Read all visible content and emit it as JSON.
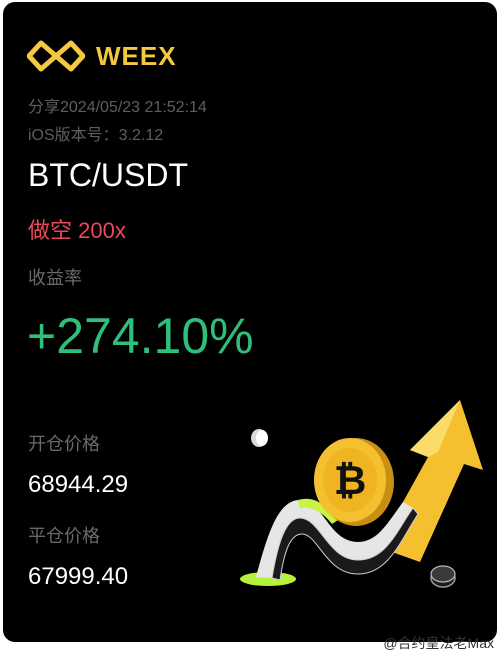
{
  "brand": {
    "name": "WEEX",
    "color": "#f5c842",
    "logo_icon": "weex-logo-icon"
  },
  "meta": {
    "share_time": "分享2024/05/23 21:52:14",
    "ios_version": "iOS版本号：3.2.12"
  },
  "trade": {
    "pair": "BTC/USDT",
    "side": "做空",
    "leverage": "200x",
    "yield_label": "收益率",
    "yield_value": "+274.10%",
    "open_label": "开仓价格",
    "open_price": "68944.29",
    "close_label": "平仓价格",
    "close_price": "67999.40"
  },
  "colors": {
    "background": "#000000",
    "positive": "#2fbf7b",
    "short": "#e9495a",
    "muted": "#5e5e5e",
    "coin": "#f5c030",
    "arrow": "#f5c030",
    "swoosh_green": "#b7f23a"
  },
  "illustration": {
    "icons": [
      "bitcoin-coin-icon",
      "up-arrow-icon",
      "swoosh-icon"
    ]
  },
  "watermark": {
    "text": "@合约皇法老Max"
  }
}
